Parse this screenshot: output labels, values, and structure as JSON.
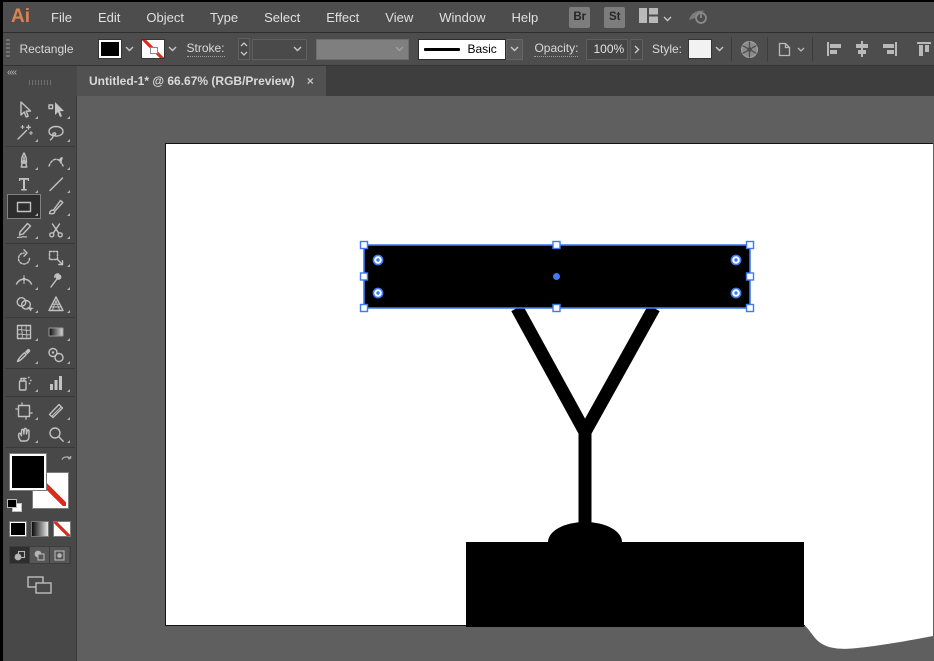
{
  "menubar": {
    "logo": "Ai",
    "items": [
      "File",
      "Edit",
      "Object",
      "Type",
      "Select",
      "Effect",
      "View",
      "Window",
      "Help"
    ],
    "bridge_button": "Br",
    "stock_button": "St"
  },
  "controlbar": {
    "selection_type_label": "Rectangle",
    "stroke_label": "Stroke:",
    "brush_name": "Basic",
    "opacity_label": "Opacity:",
    "opacity_value": "100%",
    "style_label": "Style:"
  },
  "tabbar": {
    "document_tab": "Untitled-1* @ 66.67% (RGB/Preview)",
    "close_glyph": "×",
    "panel_collapse_glyph": "««"
  },
  "document": {
    "name": "Untitled-1*",
    "zoom": "66.67%",
    "color_mode": "RGB/Preview"
  },
  "toolbar": {
    "selected_tool": "rectangle",
    "tools": [
      "selection",
      "direct-selection",
      "magic-wand",
      "lasso",
      "pen",
      "curvature",
      "type",
      "line-segment",
      "rectangle",
      "paintbrush",
      "shaper",
      "scissors",
      "rotate",
      "scale",
      "width",
      "puppet-warp",
      "shape-builder",
      "perspective-grid",
      "mesh",
      "gradient",
      "eyedropper",
      "blend",
      "symbol-sprayer",
      "column-graph",
      "artboard",
      "slice",
      "hand",
      "zoom"
    ]
  },
  "appearance": {
    "fill_color": "#000000",
    "stroke": "none"
  },
  "colors": {
    "selection_blue": "#3e7af2",
    "logo_orange": "#dd8255",
    "artboard_bg": "#ffffff",
    "pasteboard_bg": "#5f5f5f",
    "none_red": "#d92c1e"
  }
}
